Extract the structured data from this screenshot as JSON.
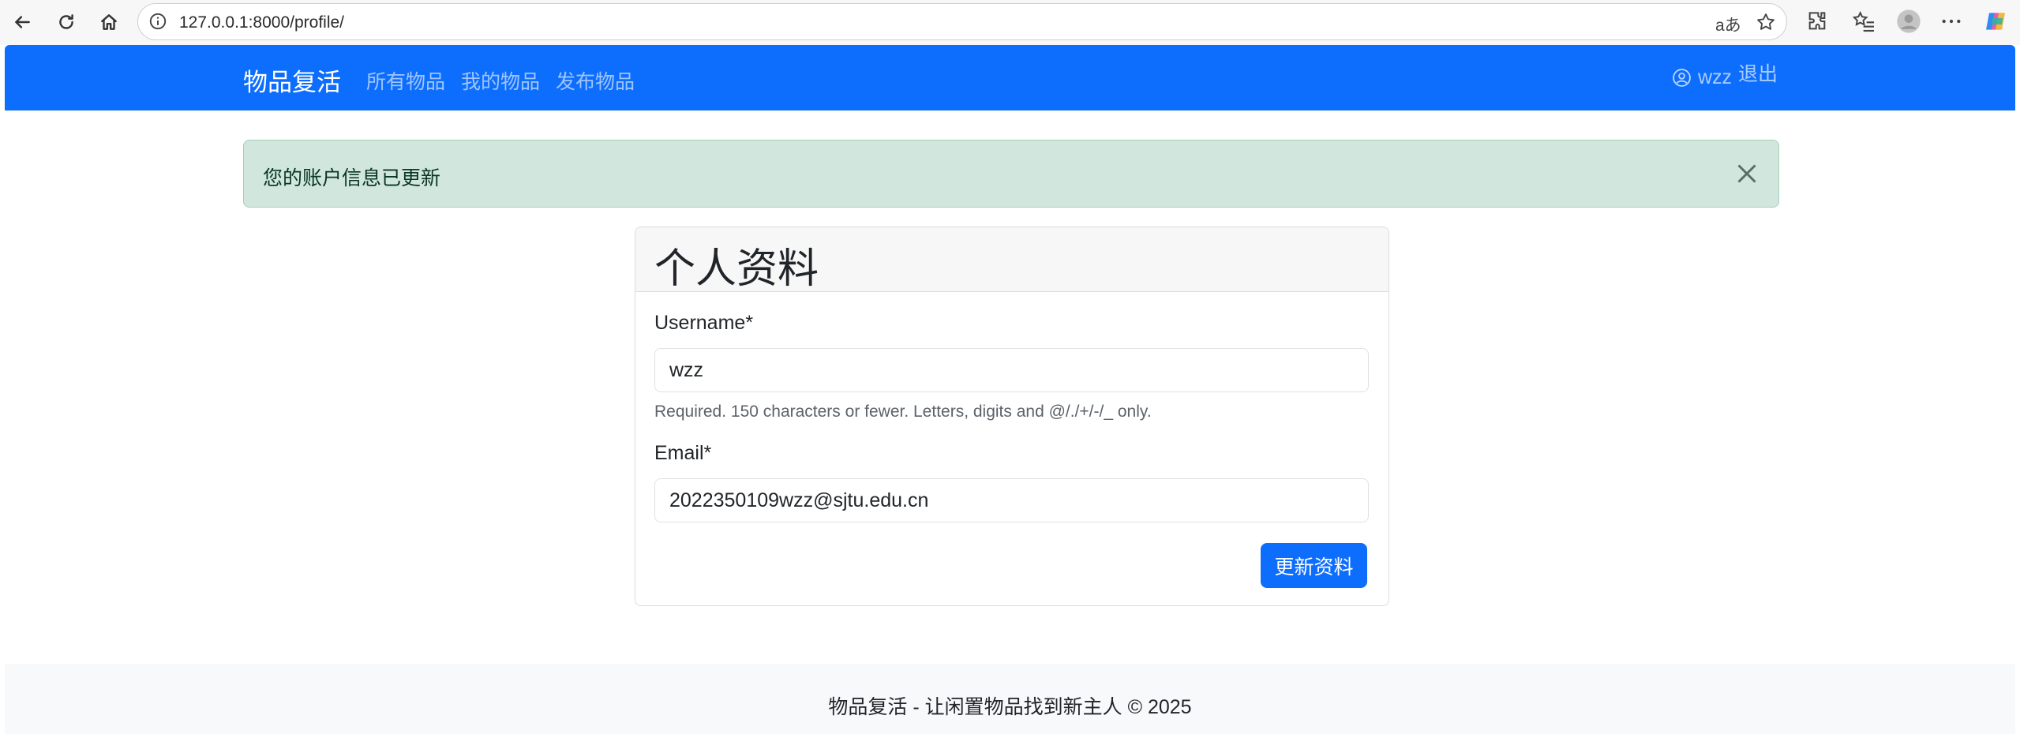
{
  "browser": {
    "url": "127.0.0.1:8000/profile/",
    "back_icon": "back-arrow-icon",
    "reload_icon": "reload-icon",
    "home_icon": "home-icon",
    "read_aloud_label": "aあ"
  },
  "navbar": {
    "brand": "物品复活",
    "links": [
      "所有物品",
      "我的物品",
      "发布物品"
    ],
    "username": "wzz",
    "logout": "退出",
    "bg_color": "#0d6efd"
  },
  "alert": {
    "message": "您的账户信息已更新",
    "bg_color": "#d1e7dd"
  },
  "profile_card": {
    "title": "个人资料",
    "username_label": "Username*",
    "username_value": "wzz",
    "username_help": "Required. 150 characters or fewer. Letters, digits and @/./+/-/_ only.",
    "email_label": "Email*",
    "email_value": "2022350109wzz@sjtu.edu.cn",
    "submit_label": "更新资料"
  },
  "footer": {
    "text": "物品复活 - 让闲置物品找到新主人 © 2025"
  }
}
